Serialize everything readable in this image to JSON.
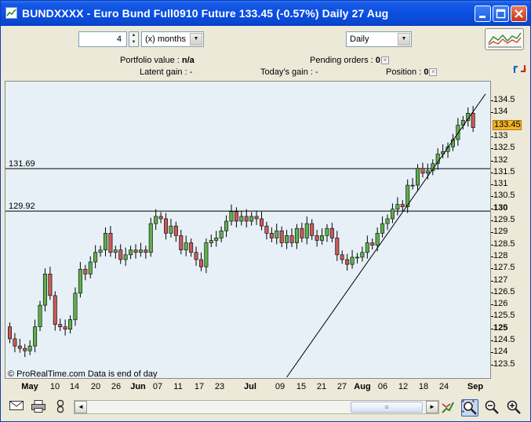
{
  "window": {
    "title": "BUNDXXXX - Euro Bund Full0910 Future     133.45 (-0.57%)     Daily  27 Aug",
    "controls": [
      "minimize",
      "maximize",
      "close"
    ]
  },
  "toolbar": {
    "period_value": "4",
    "period_unit": "(x) months",
    "interval": "Daily"
  },
  "info": {
    "portfolio_label": "Portfolio value :",
    "portfolio_value": "n/a",
    "pending_label": "Pending orders :",
    "pending_value": "0",
    "latent_label": "Latent gain :",
    "latent_value": "-",
    "today_label": "Today's gain :",
    "today_value": "-",
    "position_label": "Position :",
    "position_value": "0"
  },
  "chart": {
    "watermark": "© ProRealTime.com  Data is end of day",
    "level_lines": [
      {
        "label": "131.69",
        "value": 131.69
      },
      {
        "label": "129.92",
        "value": 129.92
      }
    ],
    "last_price": "133.45",
    "y_ticks": [
      {
        "label": "134.5",
        "bold": false
      },
      {
        "label": "134",
        "bold": false
      },
      {
        "label": "133",
        "bold": false
      },
      {
        "label": "132.5",
        "bold": false
      },
      {
        "label": "132",
        "bold": false
      },
      {
        "label": "131.5",
        "bold": false
      },
      {
        "label": "131",
        "bold": false
      },
      {
        "label": "130.5",
        "bold": false
      },
      {
        "label": "130",
        "bold": true
      },
      {
        "label": "129.5",
        "bold": false
      },
      {
        "label": "129",
        "bold": false
      },
      {
        "label": "128.5",
        "bold": false
      },
      {
        "label": "128",
        "bold": false
      },
      {
        "label": "127.5",
        "bold": false
      },
      {
        "label": "127",
        "bold": false
      },
      {
        "label": "126.5",
        "bold": false
      },
      {
        "label": "126",
        "bold": false
      },
      {
        "label": "125.5",
        "bold": false
      },
      {
        "label": "125",
        "bold": true
      },
      {
        "label": "124.5",
        "bold": false
      },
      {
        "label": "124",
        "bold": false
      },
      {
        "label": "123.5",
        "bold": false
      }
    ],
    "x_ticks": [
      {
        "label": "May",
        "bold": true
      },
      {
        "label": "10",
        "bold": false
      },
      {
        "label": "14",
        "bold": false
      },
      {
        "label": "20",
        "bold": false
      },
      {
        "label": "26",
        "bold": false
      },
      {
        "label": "Jun",
        "bold": true
      },
      {
        "label": "07",
        "bold": false
      },
      {
        "label": "11",
        "bold": false
      },
      {
        "label": "17",
        "bold": false
      },
      {
        "label": "23",
        "bold": false
      },
      {
        "label": "Jul",
        "bold": true
      },
      {
        "label": "09",
        "bold": false
      },
      {
        "label": "15",
        "bold": false
      },
      {
        "label": "21",
        "bold": false
      },
      {
        "label": "27",
        "bold": false
      },
      {
        "label": "Aug",
        "bold": true
      },
      {
        "label": "06",
        "bold": false
      },
      {
        "label": "12",
        "bold": false
      },
      {
        "label": "18",
        "bold": false
      },
      {
        "label": "24",
        "bold": false
      },
      {
        "label": "Sep",
        "bold": true
      }
    ],
    "colors": {
      "up": "#5fae4c",
      "down": "#c85a5a",
      "background": "#e6f0f6",
      "price_tag": "#f6b42a"
    },
    "closes": [
      124.6,
      124.3,
      124.2,
      124.1,
      124.3,
      125.1,
      126.0,
      127.3,
      126.4,
      125.2,
      125.1,
      125.0,
      125.4,
      126.5,
      127.5,
      127.3,
      127.8,
      128.2,
      128.3,
      129.0,
      128.2,
      128.3,
      127.9,
      128.1,
      128.3,
      128.2,
      128.3,
      128.2,
      129.4,
      129.7,
      129.6,
      129.0,
      129.3,
      128.9,
      128.3,
      128.6,
      128.2,
      127.9,
      127.6,
      128.6,
      128.7,
      128.8,
      129.1,
      129.5,
      129.9,
      129.5,
      129.7,
      129.5,
      129.7,
      129.6,
      129.3,
      129.0,
      128.8,
      129.1,
      128.6,
      128.9,
      128.6,
      129.2,
      128.8,
      129.4,
      128.9,
      128.7,
      128.9,
      129.2,
      128.8,
      128.1,
      127.9,
      127.7,
      128.0,
      128.0,
      128.2,
      128.6,
      128.5,
      129.0,
      129.4,
      129.6,
      130.0,
      130.2,
      130.1,
      131.0,
      131.0,
      131.7,
      131.5,
      131.6,
      131.9,
      132.3,
      132.4,
      132.6,
      132.9,
      133.5,
      133.7,
      134.0,
      133.4
    ],
    "trendline": [
      {
        "x": 55,
        "y": 123.0
      },
      {
        "x": 94,
        "y": 134.8
      }
    ]
  },
  "bottom": {
    "scroll_left": "◄",
    "scroll_right": "►"
  }
}
